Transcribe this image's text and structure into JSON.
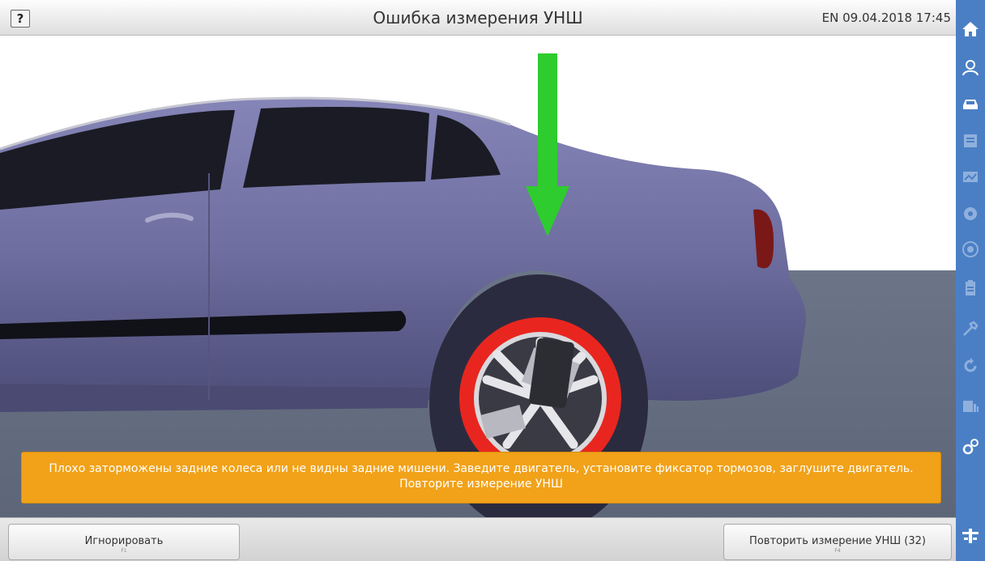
{
  "header": {
    "help_label": "?",
    "title": "Ошибка измерения УНШ",
    "language": "EN",
    "datetime": "09.04.2018 17:45"
  },
  "message": {
    "line1": "Плохо заторможены задние колеса или не видны задние мишени. Заведите двигатель, установите фиксатор тормозов, заглушите двигатель.",
    "line2": "Повторите измерение УНШ"
  },
  "buttons": {
    "ignore": {
      "label": "Игнорировать",
      "key": "F1"
    },
    "repeat": {
      "label": "Повторить измерение УНШ (32)",
      "key": "F4"
    }
  },
  "sidebar": {
    "items": [
      "home-icon",
      "customer-icon",
      "vehicle-icon",
      "specifications-icon",
      "inspection-icon",
      "measurement-icon",
      "alignment-icon",
      "report-icon",
      "adjustment-icon",
      "refresh-icon",
      "database-icon",
      "settings-icon",
      "lift-icon"
    ]
  },
  "colors": {
    "sidebar": "#4a7fc5",
    "message_bg": "#f1a219",
    "car_body": "#6f6fa0",
    "arrow": "#2ecc2e",
    "wheel_highlight": "#e8261f"
  }
}
